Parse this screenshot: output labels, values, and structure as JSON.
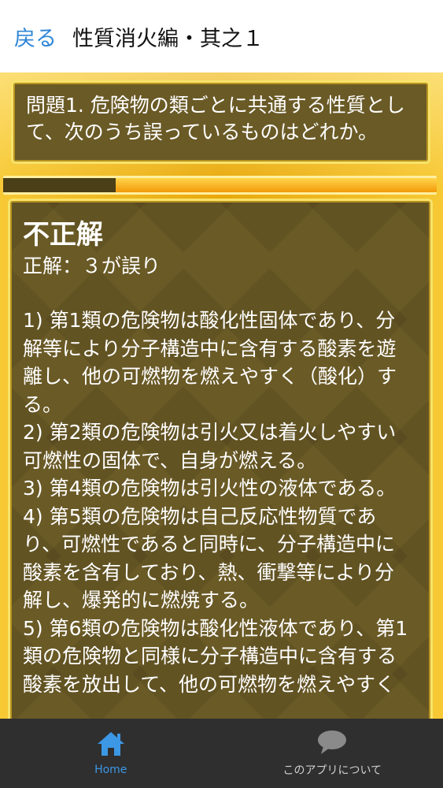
{
  "header": {
    "back_label": "戻る",
    "title": "性質消火編・其之１"
  },
  "question": {
    "text": "問題1. 危険物の類ごとに共通する性質として、次のうち誤っているものはどれか。"
  },
  "progress": {
    "fraction": 0.74
  },
  "answer": {
    "result": "不正解",
    "correct": "正解：３が誤り",
    "lines": [
      "1) 第1類の危険物は酸化性固体であり、分",
      "解等により分子構造中に含有する酸素を遊",
      "離し、他の可燃物を燃えやすく（酸化）す",
      "る。",
      "2) 第2類の危険物は引火又は着火しやすい",
      "可燃性の固体で、自身が燃える。",
      "3) 第4類の危険物は引火性の液体である。",
      "4) 第5類の危険物は自己反応性物質であ",
      "り、可燃性であると同時に、分子構造中に",
      "酸素を含有しており、熱、衝撃等により分",
      "解し、爆発的に燃焼する。",
      "5) 第6類の危険物は酸化性液体であり、第1",
      "類の危険物と同様に分子構造中に含有する",
      "酸素を放出して、他の可燃物を燃えやすく"
    ]
  },
  "nav": {
    "home_label": "Home",
    "about_label": "このアプリについて",
    "home_icon": "home-icon",
    "about_icon": "speech-bubble-icon"
  },
  "colors": {
    "accent": "#2f86d6",
    "gold": "#f1b71a",
    "panel": "#6a5a26",
    "nav_bg": "#2f2f2f"
  }
}
